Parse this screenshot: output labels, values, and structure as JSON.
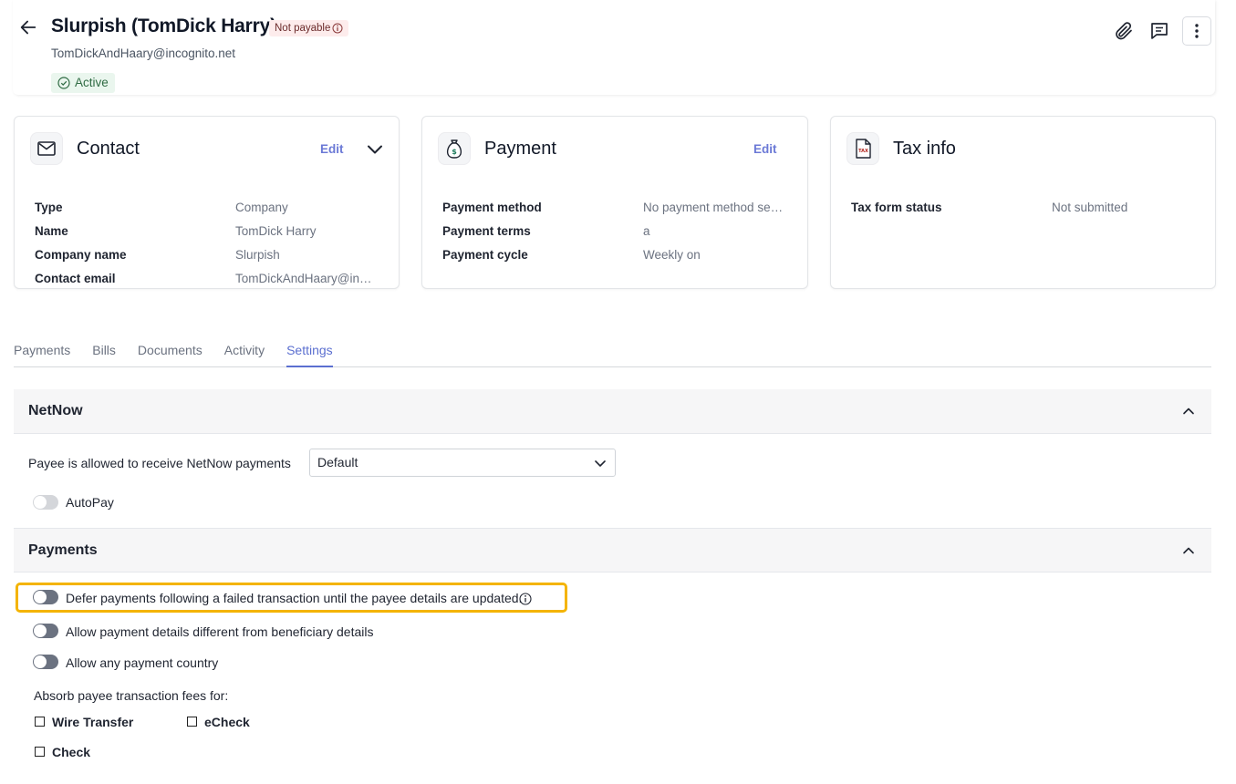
{
  "header": {
    "title": "Slurpish (TomDick Harry)",
    "status_badge": "Not payable",
    "email": "TomDickAndHaary@incognito.net",
    "active_label": "Active"
  },
  "cards": {
    "contact": {
      "title": "Contact",
      "edit_label": "Edit",
      "rows": [
        {
          "key": "Type",
          "value": "Company"
        },
        {
          "key": "Name",
          "value": "TomDick Harry"
        },
        {
          "key": "Company name",
          "value": "Slurpish"
        },
        {
          "key": "Contact email",
          "value": "TomDickAndHaary@in…"
        }
      ]
    },
    "payment": {
      "title": "Payment",
      "edit_label": "Edit",
      "rows": [
        {
          "key": "Payment method",
          "value": "No payment method se…"
        },
        {
          "key": "Payment terms",
          "value": "a"
        },
        {
          "key": "Payment cycle",
          "value": "Weekly on"
        }
      ]
    },
    "tax": {
      "title": "Tax info",
      "rows": [
        {
          "key": "Tax form status",
          "value": "Not submitted"
        }
      ]
    }
  },
  "tabs": [
    "Payments",
    "Bills",
    "Documents",
    "Activity",
    "Settings"
  ],
  "active_tab": "Settings",
  "netnow": {
    "title": "NetNow",
    "receive_label": "Payee is allowed to receive NetNow payments",
    "receive_value": "Default",
    "autopay_label": "AutoPay"
  },
  "payments": {
    "title": "Payments",
    "defer_label": "Defer payments following a failed transaction until the payee details are updated.",
    "allow_diff_label": "Allow payment details different from beneficiary details",
    "allow_country_label": "Allow any payment country",
    "absorb_label": "Absorb payee transaction fees for:",
    "fees": [
      "Wire Transfer",
      "eCheck",
      "Check"
    ]
  },
  "colors": {
    "accent": "#5b6fd0",
    "highlight": "#f4b400",
    "not_payable_bg": "#fdecec",
    "active_bg": "#eaf6ee"
  }
}
